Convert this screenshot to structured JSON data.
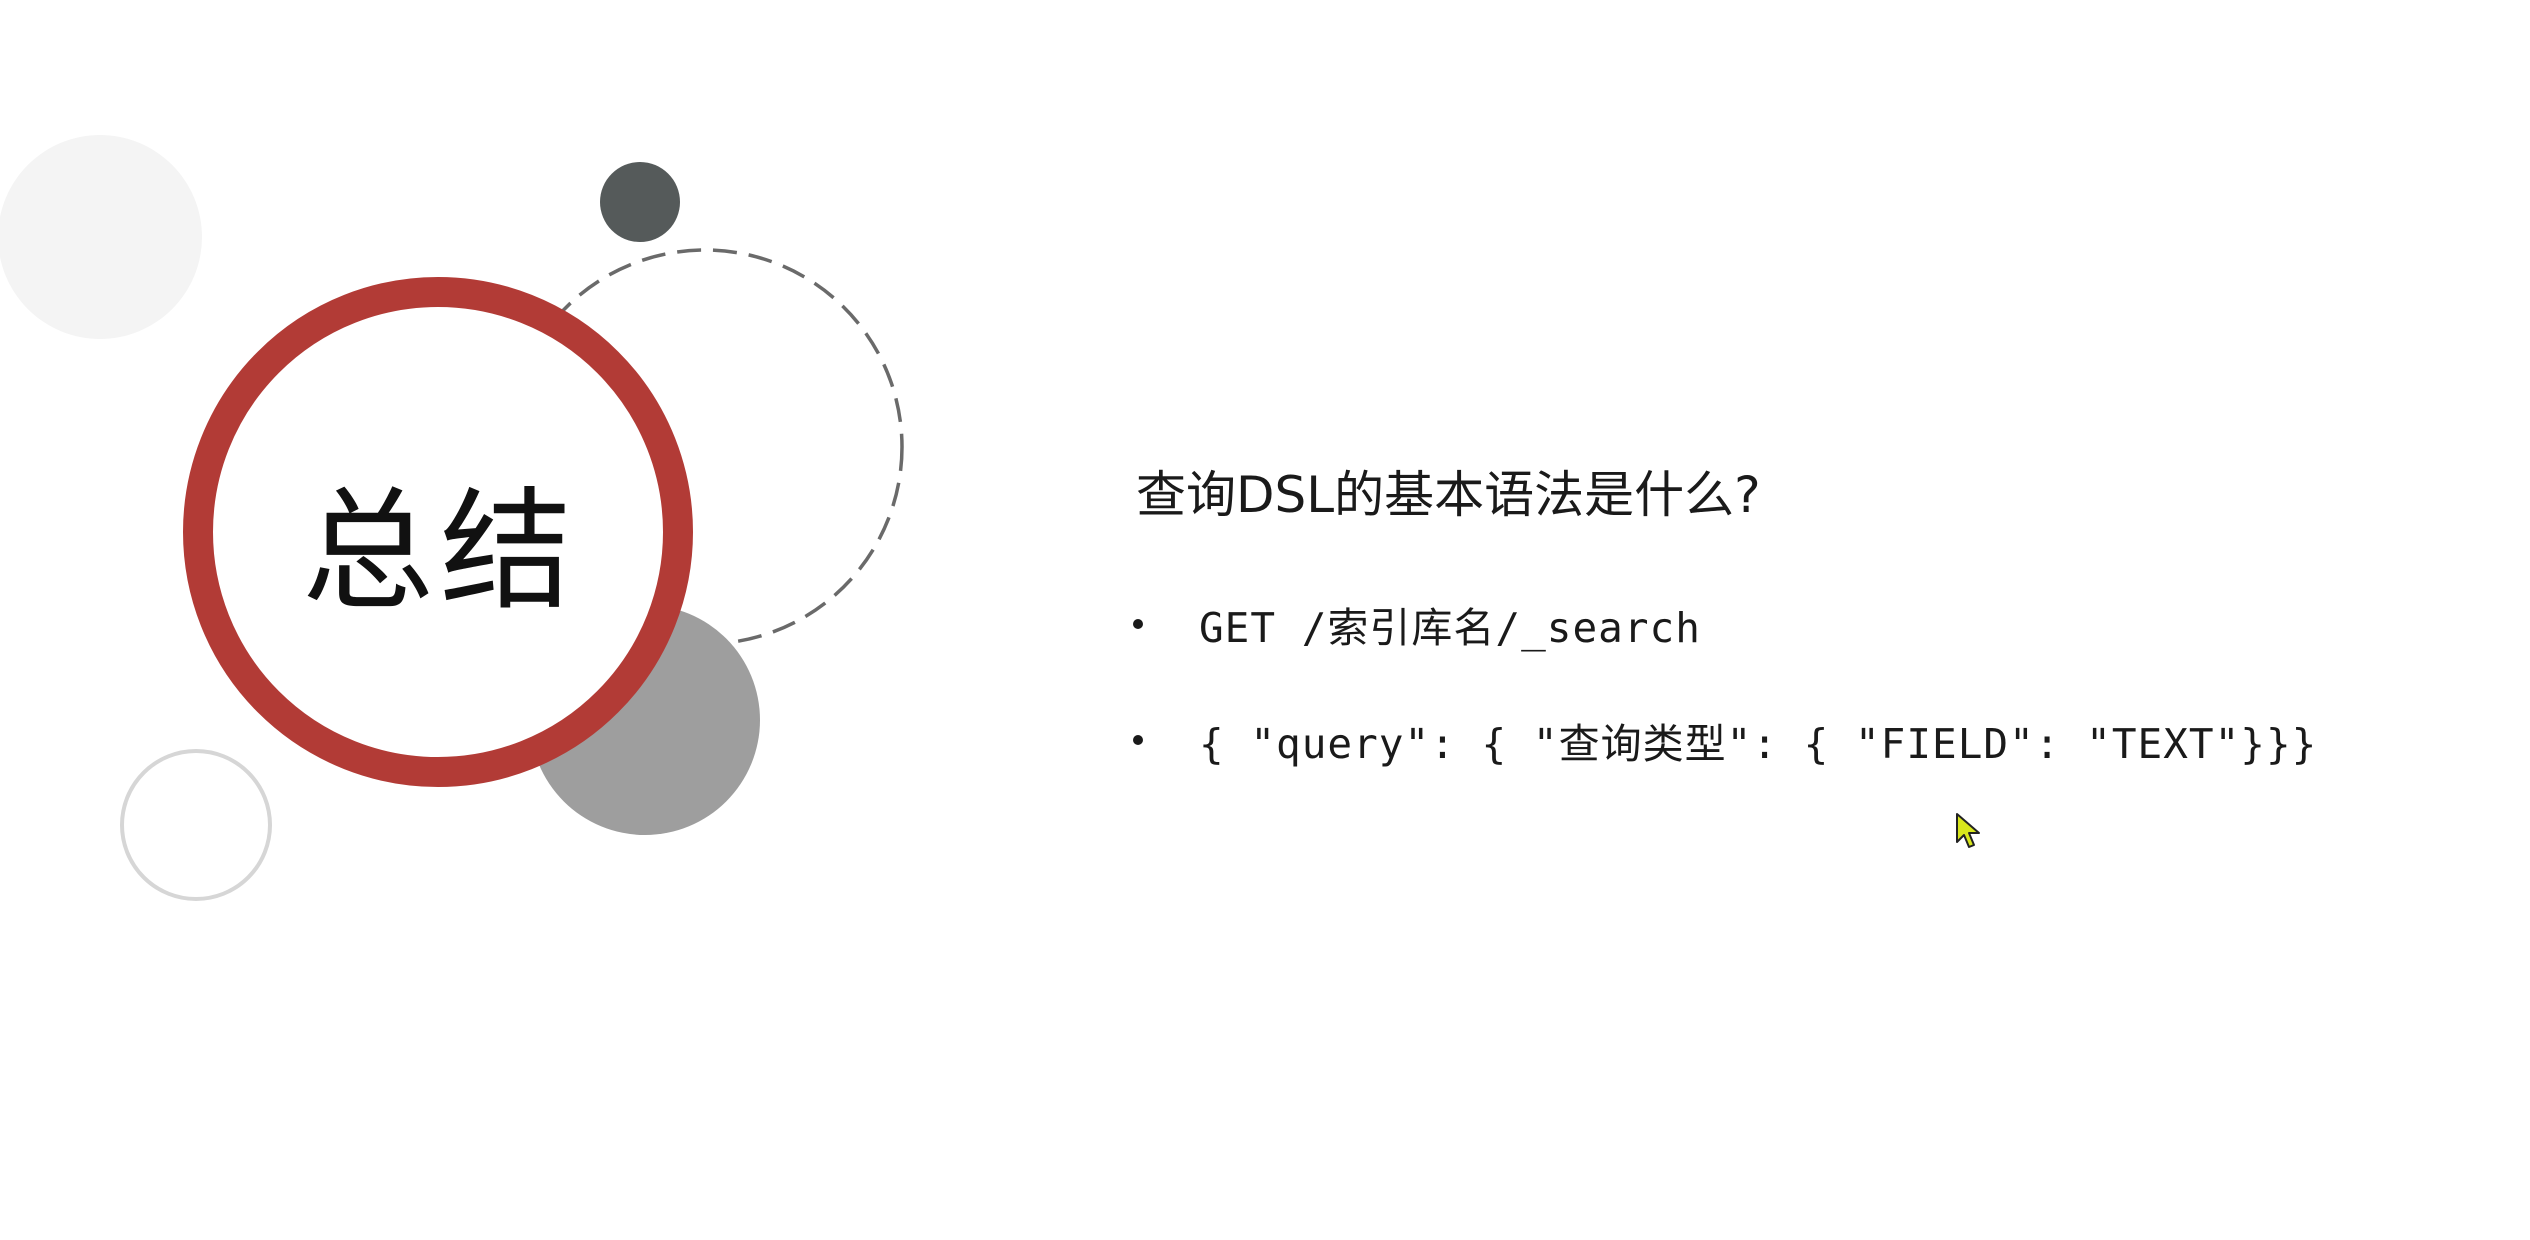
{
  "slide": {
    "title": "总结",
    "question": "查询DSL的基本语法是什么?",
    "bullets": [
      {
        "text": "GET /索引库名/_search"
      },
      {
        "text": "{ \"query\": { \"查询类型\": { \"FIELD\": \"TEXT\"}}}"
      }
    ]
  },
  "colors": {
    "accent_ring": "#b23b36",
    "dark_dot": "#555a5a",
    "gray_circle": "#9e9e9e",
    "light_circle": "#f4f4f4",
    "outline_circle": "#d6d6d6",
    "dashed_circle": "#6a6a6a",
    "cursor": "#d8e61c"
  },
  "icons": {
    "cursor": "mouse-pointer-icon"
  }
}
